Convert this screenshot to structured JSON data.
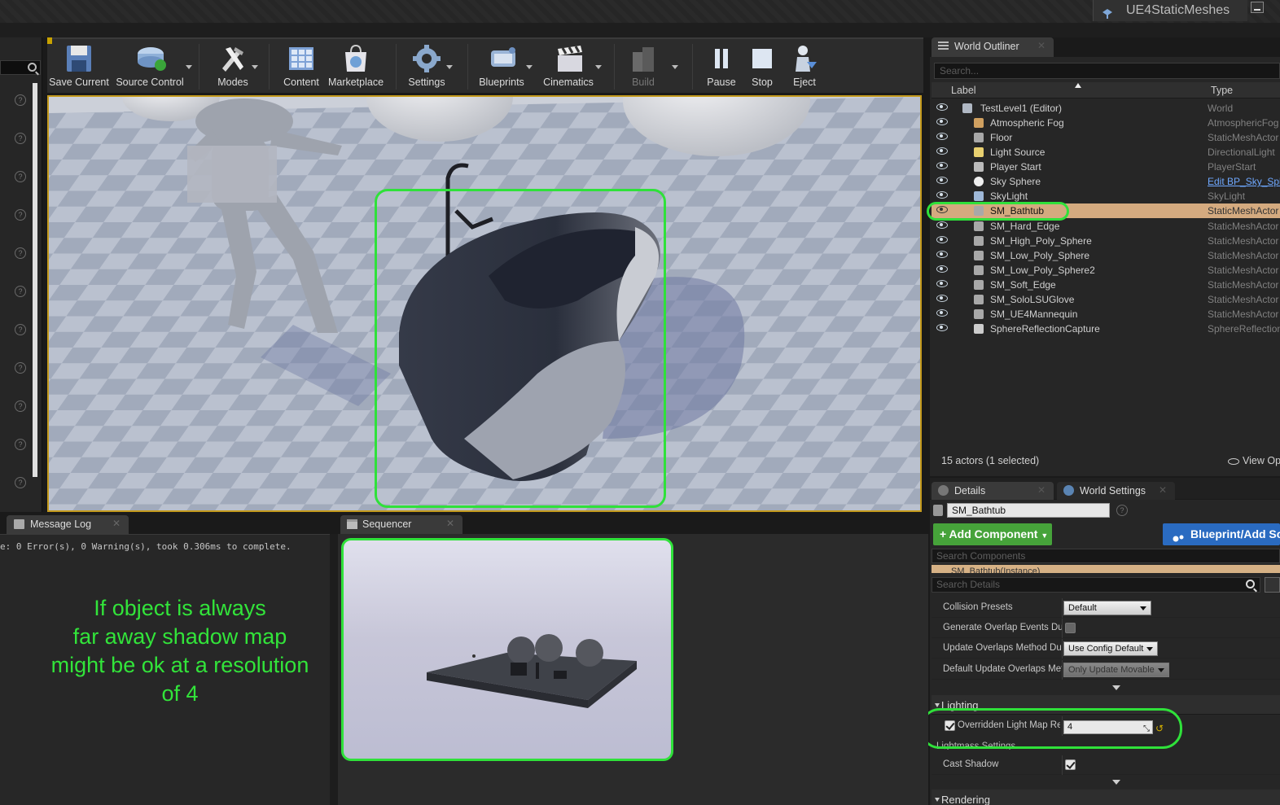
{
  "window": {
    "project_name": "UE4StaticMeshes"
  },
  "toolbar": {
    "buttons": [
      {
        "label": "Save Current"
      },
      {
        "label": "Source Control"
      },
      {
        "label": "Modes"
      },
      {
        "label": "Content"
      },
      {
        "label": "Marketplace"
      },
      {
        "label": "Settings"
      },
      {
        "label": "Blueprints"
      },
      {
        "label": "Cinematics"
      },
      {
        "label": "Build"
      },
      {
        "label": "Pause"
      },
      {
        "label": "Stop"
      },
      {
        "label": "Eject"
      }
    ]
  },
  "outliner": {
    "tab_label": "World Outliner",
    "search_placeholder": "Search...",
    "col_label": "Label",
    "col_type": "Type",
    "rows": [
      {
        "label": "TestLevel1 (Editor)",
        "type": "World",
        "icon": "world-icon"
      },
      {
        "label": "Atmospheric Fog",
        "type": "AtmosphericFog",
        "icon": "fog-icon"
      },
      {
        "label": "Floor",
        "type": "StaticMeshActor",
        "icon": "static-mesh-icon"
      },
      {
        "label": "Light Source",
        "type": "DirectionalLight",
        "icon": "light-icon"
      },
      {
        "label": "Player Start",
        "type": "PlayerStart",
        "icon": "player-start-icon"
      },
      {
        "label": "Sky Sphere",
        "type": "Edit BP_Sky_Sphere",
        "icon": "sphere-icon"
      },
      {
        "label": "SkyLight",
        "type": "SkyLight",
        "icon": "skylight-icon"
      },
      {
        "label": "SM_Bathtub",
        "type": "StaticMeshActor",
        "icon": "static-mesh-icon"
      },
      {
        "label": "SM_Hard_Edge",
        "type": "StaticMeshActor",
        "icon": "static-mesh-icon"
      },
      {
        "label": "SM_High_Poly_Sphere",
        "type": "StaticMeshActor",
        "icon": "static-mesh-icon"
      },
      {
        "label": "SM_Low_Poly_Sphere",
        "type": "StaticMeshActor",
        "icon": "static-mesh-icon"
      },
      {
        "label": "SM_Low_Poly_Sphere2",
        "type": "StaticMeshActor",
        "icon": "static-mesh-icon"
      },
      {
        "label": "SM_Soft_Edge",
        "type": "StaticMeshActor",
        "icon": "static-mesh-icon"
      },
      {
        "label": "SM_SoloLSUGlove",
        "type": "StaticMeshActor",
        "icon": "static-mesh-icon"
      },
      {
        "label": "SM_UE4Mannequin",
        "type": "StaticMeshActor",
        "icon": "static-mesh-icon"
      },
      {
        "label": "SphereReflectionCapture",
        "type": "SphereReflectionCapture",
        "icon": "reflection-capture-icon"
      }
    ],
    "selected_row": "SM_Bathtub",
    "status": "15 actors (1 selected)",
    "view_options": "View Options"
  },
  "details": {
    "tab_details": "Details",
    "tab_world_settings": "World Settings",
    "actor_name": "SM_Bathtub",
    "add_component": "+ Add Component",
    "blueprint_button": "Blueprint/Add Script",
    "search_components_placeholder": "Search Components",
    "component_row": "SM_Bathtub(Instance)",
    "search_details_placeholder": "Search Details",
    "collision_presets_label": "Collision Presets",
    "collision_presets_value": "Default",
    "generate_overlap_label": "Generate Overlap Events During Level Streaming",
    "update_overlaps_label": "Update Overlaps Method During Level Streaming",
    "update_overlaps_value": "Use Config Default",
    "default_update_overlaps_label": "Default Update Overlaps Method",
    "default_update_overlaps_value": "Only Update Movable",
    "lighting_category": "Lighting",
    "overridden_light_map_label": "Overridden Light Map Res",
    "overridden_light_map_value": "4",
    "lightmass_settings": "Lightmass Settings",
    "cast_shadow_label": "Cast Shadow",
    "rendering_category": "Rendering"
  },
  "message_log": {
    "tab_label": "Message Log",
    "line": "e: 0 Error(s), 0 Warning(s), took 0.306ms to complete."
  },
  "annotation": {
    "lines": [
      "If object is always",
      "far away shadow map",
      "might be ok at a resolution",
      "of 4"
    ]
  },
  "sequencer": {
    "tab_label": "Sequencer"
  },
  "colors": {
    "highlight": "#2fe13a",
    "selection": "#d4aa7f",
    "add_component": "#46a33a",
    "blueprint": "#2a6bc1"
  }
}
